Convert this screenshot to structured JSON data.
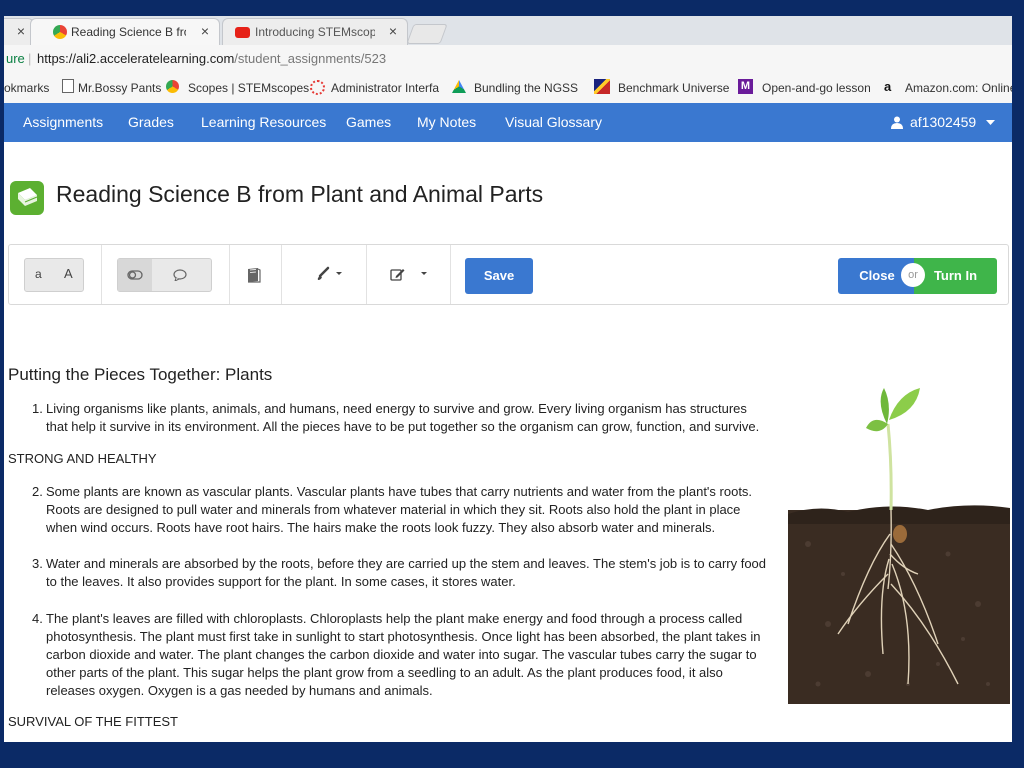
{
  "browser": {
    "tabs": [
      {
        "title": "Reading Science B from P",
        "close": "×"
      },
      {
        "title": "Introducing STEMscopes",
        "close": "×"
      }
    ],
    "left_tab_close": "×",
    "url_prefix_fragment": "ure",
    "url_host": "https://ali2.acceleratelearning.com",
    "url_path": "/student_assignments/523",
    "bookmarks": [
      "okmarks",
      "Mr.Bossy Pants",
      "Scopes | STEMscopes",
      "Administrator Interfa",
      "Bundling the NGSS |",
      "Benchmark Universe",
      "Open-and-go lesson",
      "Amazon.com: Online"
    ]
  },
  "nav": {
    "items": [
      "Assignments",
      "Grades",
      "Learning Resources",
      "Games",
      "My Notes",
      "Visual Glossary"
    ],
    "user": "af1302459"
  },
  "page": {
    "title": "Reading Science B from Plant and Animal Parts"
  },
  "toolbar": {
    "font_small": "a",
    "font_large": "A",
    "save": "Save",
    "close": "Close",
    "or": "or",
    "turn_in": "Turn In"
  },
  "article": {
    "heading": "Putting the Pieces Together: Plants",
    "section1": "STRONG AND HEALTHY",
    "section2": "SURVIVAL OF THE FITTEST",
    "items": [
      {
        "num": "1.",
        "text": "Living organisms like plants, animals, and humans, need energy to survive and grow. Every living organism has structures that help it survive in its environment. All the pieces have to be put together so the organism can grow, function, and survive."
      },
      {
        "num": "2.",
        "text": "Some plants are known as vascular plants. Vascular plants have tubes that carry nutrients and water from the plant's roots. Roots are designed to pull water and minerals from whatever material in which they sit. Roots also hold the plant in place when wind occurs. Roots have root hairs. The hairs make the roots look fuzzy. They also absorb water and minerals."
      },
      {
        "num": "3.",
        "text": "Water and minerals are absorbed by the roots, before they are carried up the stem and leaves. The stem's job is to carry food to the leaves. It also provides support for the plant. In some cases, it stores water."
      },
      {
        "num": "4.",
        "text": "The plant's leaves are filled with chloroplasts. Chloroplasts help the plant make energy and food through a process called photosynthesis. The plant must first take in sunlight to start photosynthesis. Once light has been absorbed, the plant takes in carbon dioxide and water. The plant changes the carbon dioxide and water into sugar. The vascular tubes carry the sugar to other parts of the plant. This sugar helps the plant grow from a seedling to an adult. As the plant produces food, it also releases oxygen. Oxygen is a gas needed by humans and animals."
      }
    ]
  },
  "colors": {
    "nav": "#3a78d0",
    "save": "#3a78d0",
    "close": "#3a78d0",
    "turn_in": "#3fb54a",
    "book_icon": "#5cb031",
    "frame": "#0b2a66"
  }
}
